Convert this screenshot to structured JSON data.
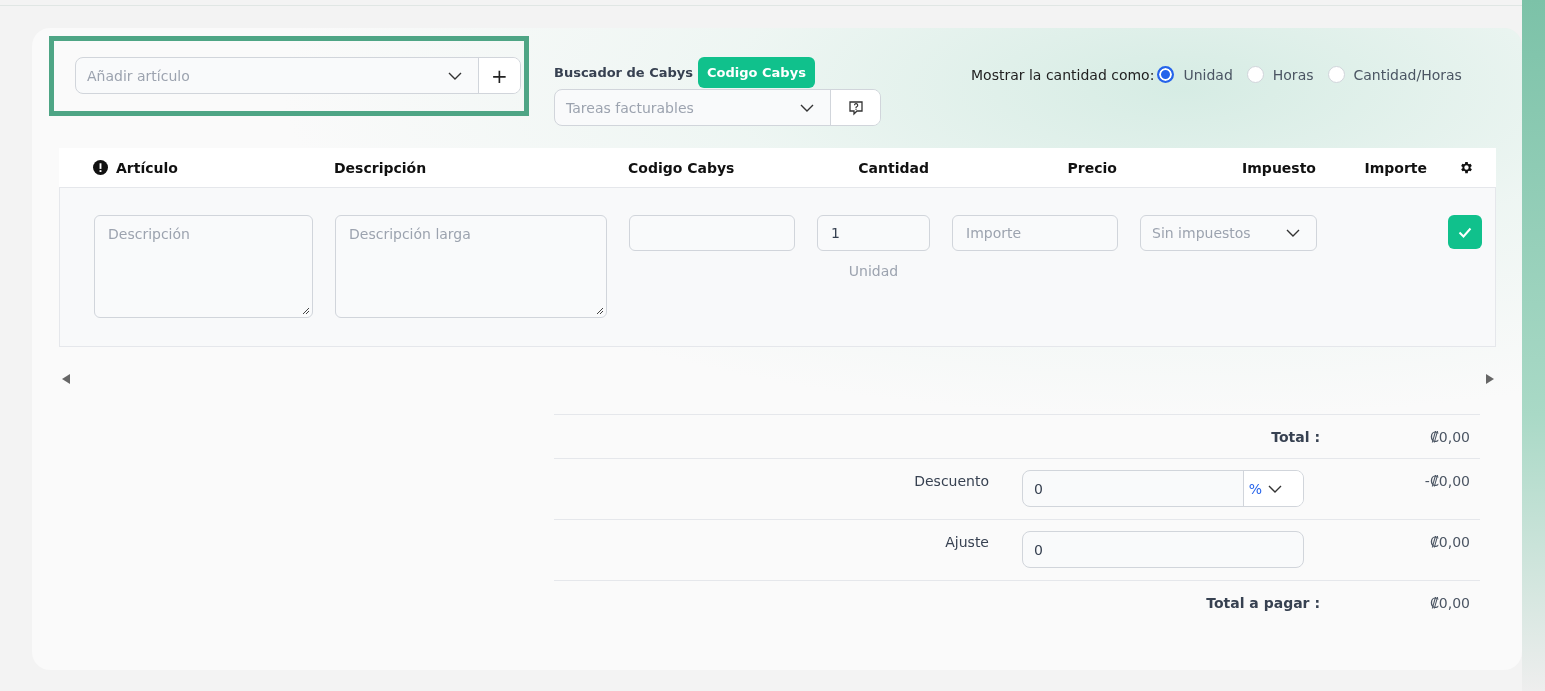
{
  "item_picker": {
    "placeholder": "Añadir artículo",
    "add_button": "+"
  },
  "cabys": {
    "label": "Buscador de Cabys",
    "badge": "Codigo Cabys",
    "select_placeholder": "Tareas facturables"
  },
  "quantity_mode": {
    "label": "Mostrar la cantidad como:",
    "options": [
      {
        "label": "Unidad",
        "selected": true
      },
      {
        "label": "Horas",
        "selected": false
      },
      {
        "label": "Cantidad/Horas",
        "selected": false
      }
    ]
  },
  "table": {
    "columns": [
      "Artículo",
      "Descripción",
      "Codigo Cabys",
      "Cantidad",
      "Precio",
      "Impuesto",
      "Importe"
    ],
    "row": {
      "description_placeholder": "Descripción",
      "long_description_placeholder": "Descripción larga",
      "quantity": "1",
      "unit": "Unidad",
      "price_placeholder": "Importe",
      "tax_placeholder": "Sin impuestos"
    }
  },
  "totals": {
    "total_label": "Total :",
    "total": "₡0,00",
    "discount_label": "Descuento",
    "discount_value": "0",
    "discount_unit": "%",
    "discount_amount": "-₡0,00",
    "adjust_label": "Ajuste",
    "adjust_value": "0",
    "adjust_amount": "₡0,00",
    "grand_total_label": "Total a pagar :",
    "grand_total": "₡0,00"
  }
}
